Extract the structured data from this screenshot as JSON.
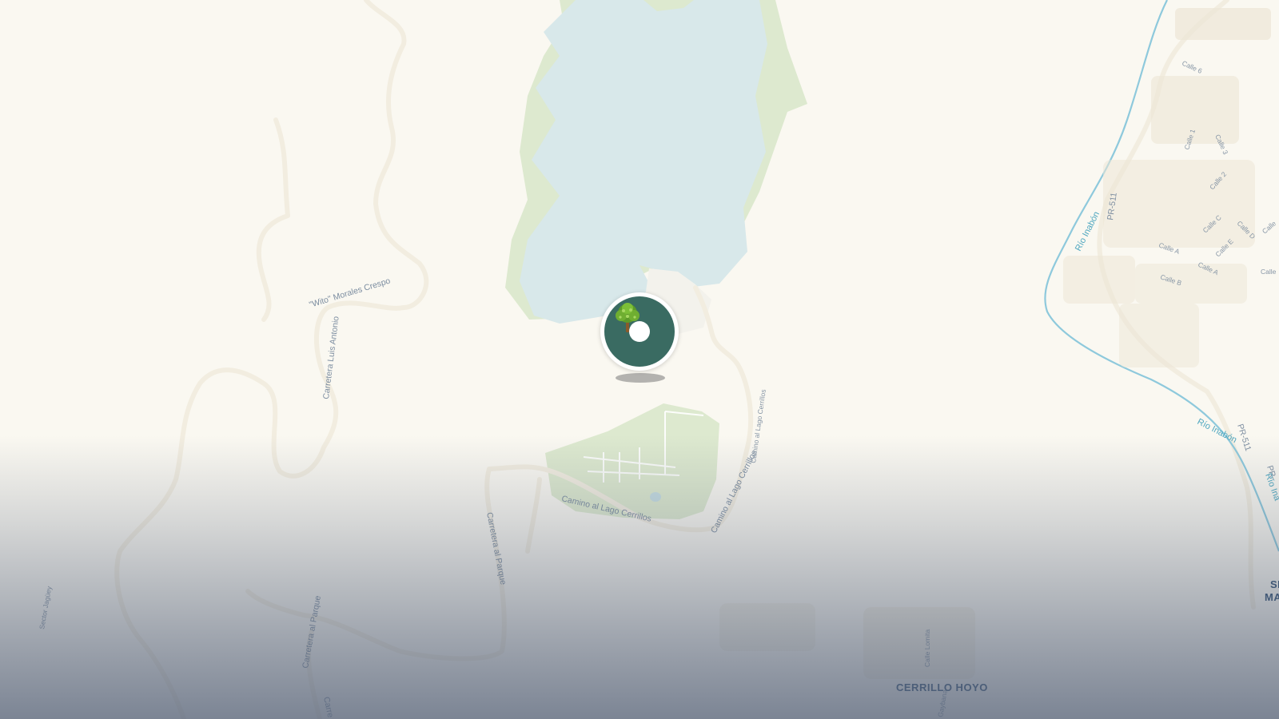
{
  "map": {
    "colors": {
      "land": "#faf8f1",
      "water": "#d8e8ea",
      "park": "#dde9cf",
      "road": "#f2ede0",
      "river": "#8ec9dc",
      "marker_ring": "#ffffff",
      "marker_fill": "#3a6b62"
    },
    "marker": {
      "icon": "tree-icon",
      "type": "park-location-pin"
    },
    "road_labels": {
      "carretera_luis_antonio": "Carretera Luis Antonio",
      "wito_morales_crespo": "\"Wito\" Morales Crespo",
      "camino_lago_cerrillos_1": "Camino al Lago Cerrillos",
      "camino_lago_cerrillos_2": "Camino al Lago Cerrillos",
      "camino_lago_cerrillos_3": "Camino al Lago Cerrillos",
      "carretera_al_parque_1": "Carretera al Parque",
      "carretera_al_parque_2": "Carretera al Parque",
      "carretera_al_parque_3": "Carre",
      "sector_jaguey": "Sector Jagüey",
      "calle_lomita": "Calle Lomita",
      "pr511_1": "PR-511",
      "pr511_2": "PR-511",
      "pr511_3": "PR-",
      "calle_6": "Calle 6",
      "calle_1": "Calle 1",
      "calle_3": "Calle 3",
      "calle_2": "Calle 2",
      "calle_c": "Calle C",
      "calle_d": "Calle D",
      "calle_e": "Calle E",
      "calle_a_1": "Calle A",
      "calle_a_2": "Calle A",
      "calle_b": "Calle B",
      "calle_edge_1": "Calle",
      "calle_edge_2": "Calle",
      "gaybana": "Gaybana"
    },
    "river_labels": {
      "rio_inabon_1": "Río Inabón",
      "rio_inabon_2": "Río Inabón",
      "rio_inabon_3": "Río Ina"
    },
    "place_labels": {
      "cerrillo_hoyo": "CERRILLO HOYO",
      "edge_1": "SI",
      "edge_2": "MA"
    }
  }
}
